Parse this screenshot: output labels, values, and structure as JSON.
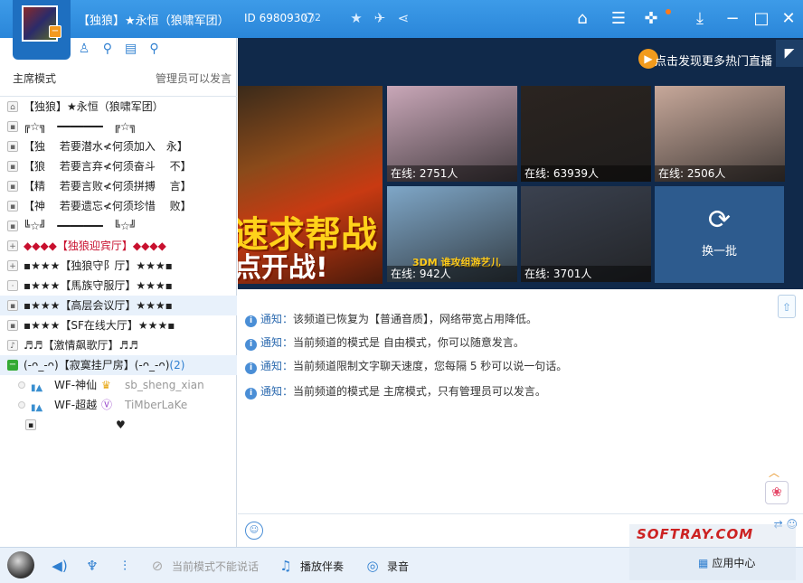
{
  "title_bar": {
    "channel_title": "【独狼】★永恒（狼啸军团）",
    "channel_id": "ID 69809307",
    "online_count": "2"
  },
  "left_panel": {
    "mode_left": "主席模式",
    "mode_right": "管理员可以发言",
    "tree": [
      {
        "icon": "home-icon",
        "text": "【独狼】★永恒（狼啸军团）",
        "style": "normal"
      },
      {
        "icon": "lock-icon",
        "text": "╔☆╗　━━━━━━━　╔☆╗",
        "style": "normal"
      },
      {
        "icon": "lock-icon",
        "text": "【独　 若要潜水≮何须加入　永】",
        "style": "normal"
      },
      {
        "icon": "lock-icon",
        "text": "【狼　 若要言弃≮何须奋斗　 不】",
        "style": "normal"
      },
      {
        "icon": "lock-icon",
        "text": "【精　 若要言败≮何须拼搏　 言】",
        "style": "normal"
      },
      {
        "icon": "lock-icon",
        "text": "【神　 若要遗忘≮何须珍惜　 败】",
        "style": "normal"
      },
      {
        "icon": "lock-icon",
        "text": "╚☆╝　━━━━━━━　╚☆╝",
        "style": "normal"
      },
      {
        "icon": "plus-icon",
        "text": "◆◆◆◆【独狼迎宾厅】◆◆◆◆",
        "style": "red"
      },
      {
        "icon": "plus-icon",
        "text": "▪★★★【独狼守阝厅】★★★▪",
        "style": "normal"
      },
      {
        "icon": "dot-icon",
        "text": "▪★★★【馬族守服厅】★★★▪",
        "style": "normal"
      },
      {
        "icon": "lock-icon",
        "text": "▪★★★【高层会议厅】★★★▪",
        "style": "selected"
      },
      {
        "icon": "lock-icon",
        "text": "▪★★★【SF在线大厅】★★★▪",
        "style": "normal"
      },
      {
        "icon": "music-icon",
        "text": "♬♬【激情飙歌厅】♬♬",
        "style": "normal"
      }
    ],
    "expanded_channel": {
      "text": "(-ᴖ_-ᴖ)【寂寞挂尸房】(-ᴖ_-ᴖ)",
      "count": "(2)"
    },
    "users": [
      {
        "name": "WF-神仙",
        "badge": "crown-icon",
        "note": "sb_sheng_xian"
      },
      {
        "name": "WF-超越",
        "badge": "v-badge-icon",
        "note": "TiMberLaKe"
      }
    ],
    "last_row_heart": "♥"
  },
  "content": {
    "live_link": "点击发现更多热门直播",
    "banner_text_1": "速求帮战",
    "banner_text_2": "点开战!",
    "thumbnails": [
      {
        "label": "在线: 2751人",
        "color": "#c9a7b8"
      },
      {
        "label": "在线: 63939人",
        "color": "#2b2420"
      },
      {
        "label": "在线: 2506人",
        "color": "#c7a89a"
      },
      {
        "label": "在线: 942人",
        "color": "#7fa7c8"
      },
      {
        "label": "在线: 3701人",
        "color": "#3b4250"
      }
    ],
    "thumb4_overlay": "3DM 谁攻组游艺儿",
    "refresh_label": "换一批"
  },
  "chat": {
    "notices": [
      {
        "label": "通知：",
        "text": "该频道已恢复为【普通音质】，网络带宽占用降低。"
      },
      {
        "label": "通知：",
        "text": "当前频道的模式是 自由模式，你可以随意发言。"
      },
      {
        "label": "通知：",
        "text": "当前频道限制文字聊天速度，您每隔 5 秒可以说一句话。"
      },
      {
        "label": "通知：",
        "text": "当前频道的模式是 主席模式，只有管理员可以发言。"
      }
    ]
  },
  "bottom_bar": {
    "cannot_speak": "当前模式不能说话",
    "play_accompaniment": "播放伴奏",
    "record": "录音",
    "app_center": "应用中心"
  },
  "watermark": {
    "text": "SOFTRAY.COM"
  },
  "colors": {
    "titlebar": "#2a86d9",
    "accent": "#2f7fd0",
    "content_bg": "#10294a"
  }
}
